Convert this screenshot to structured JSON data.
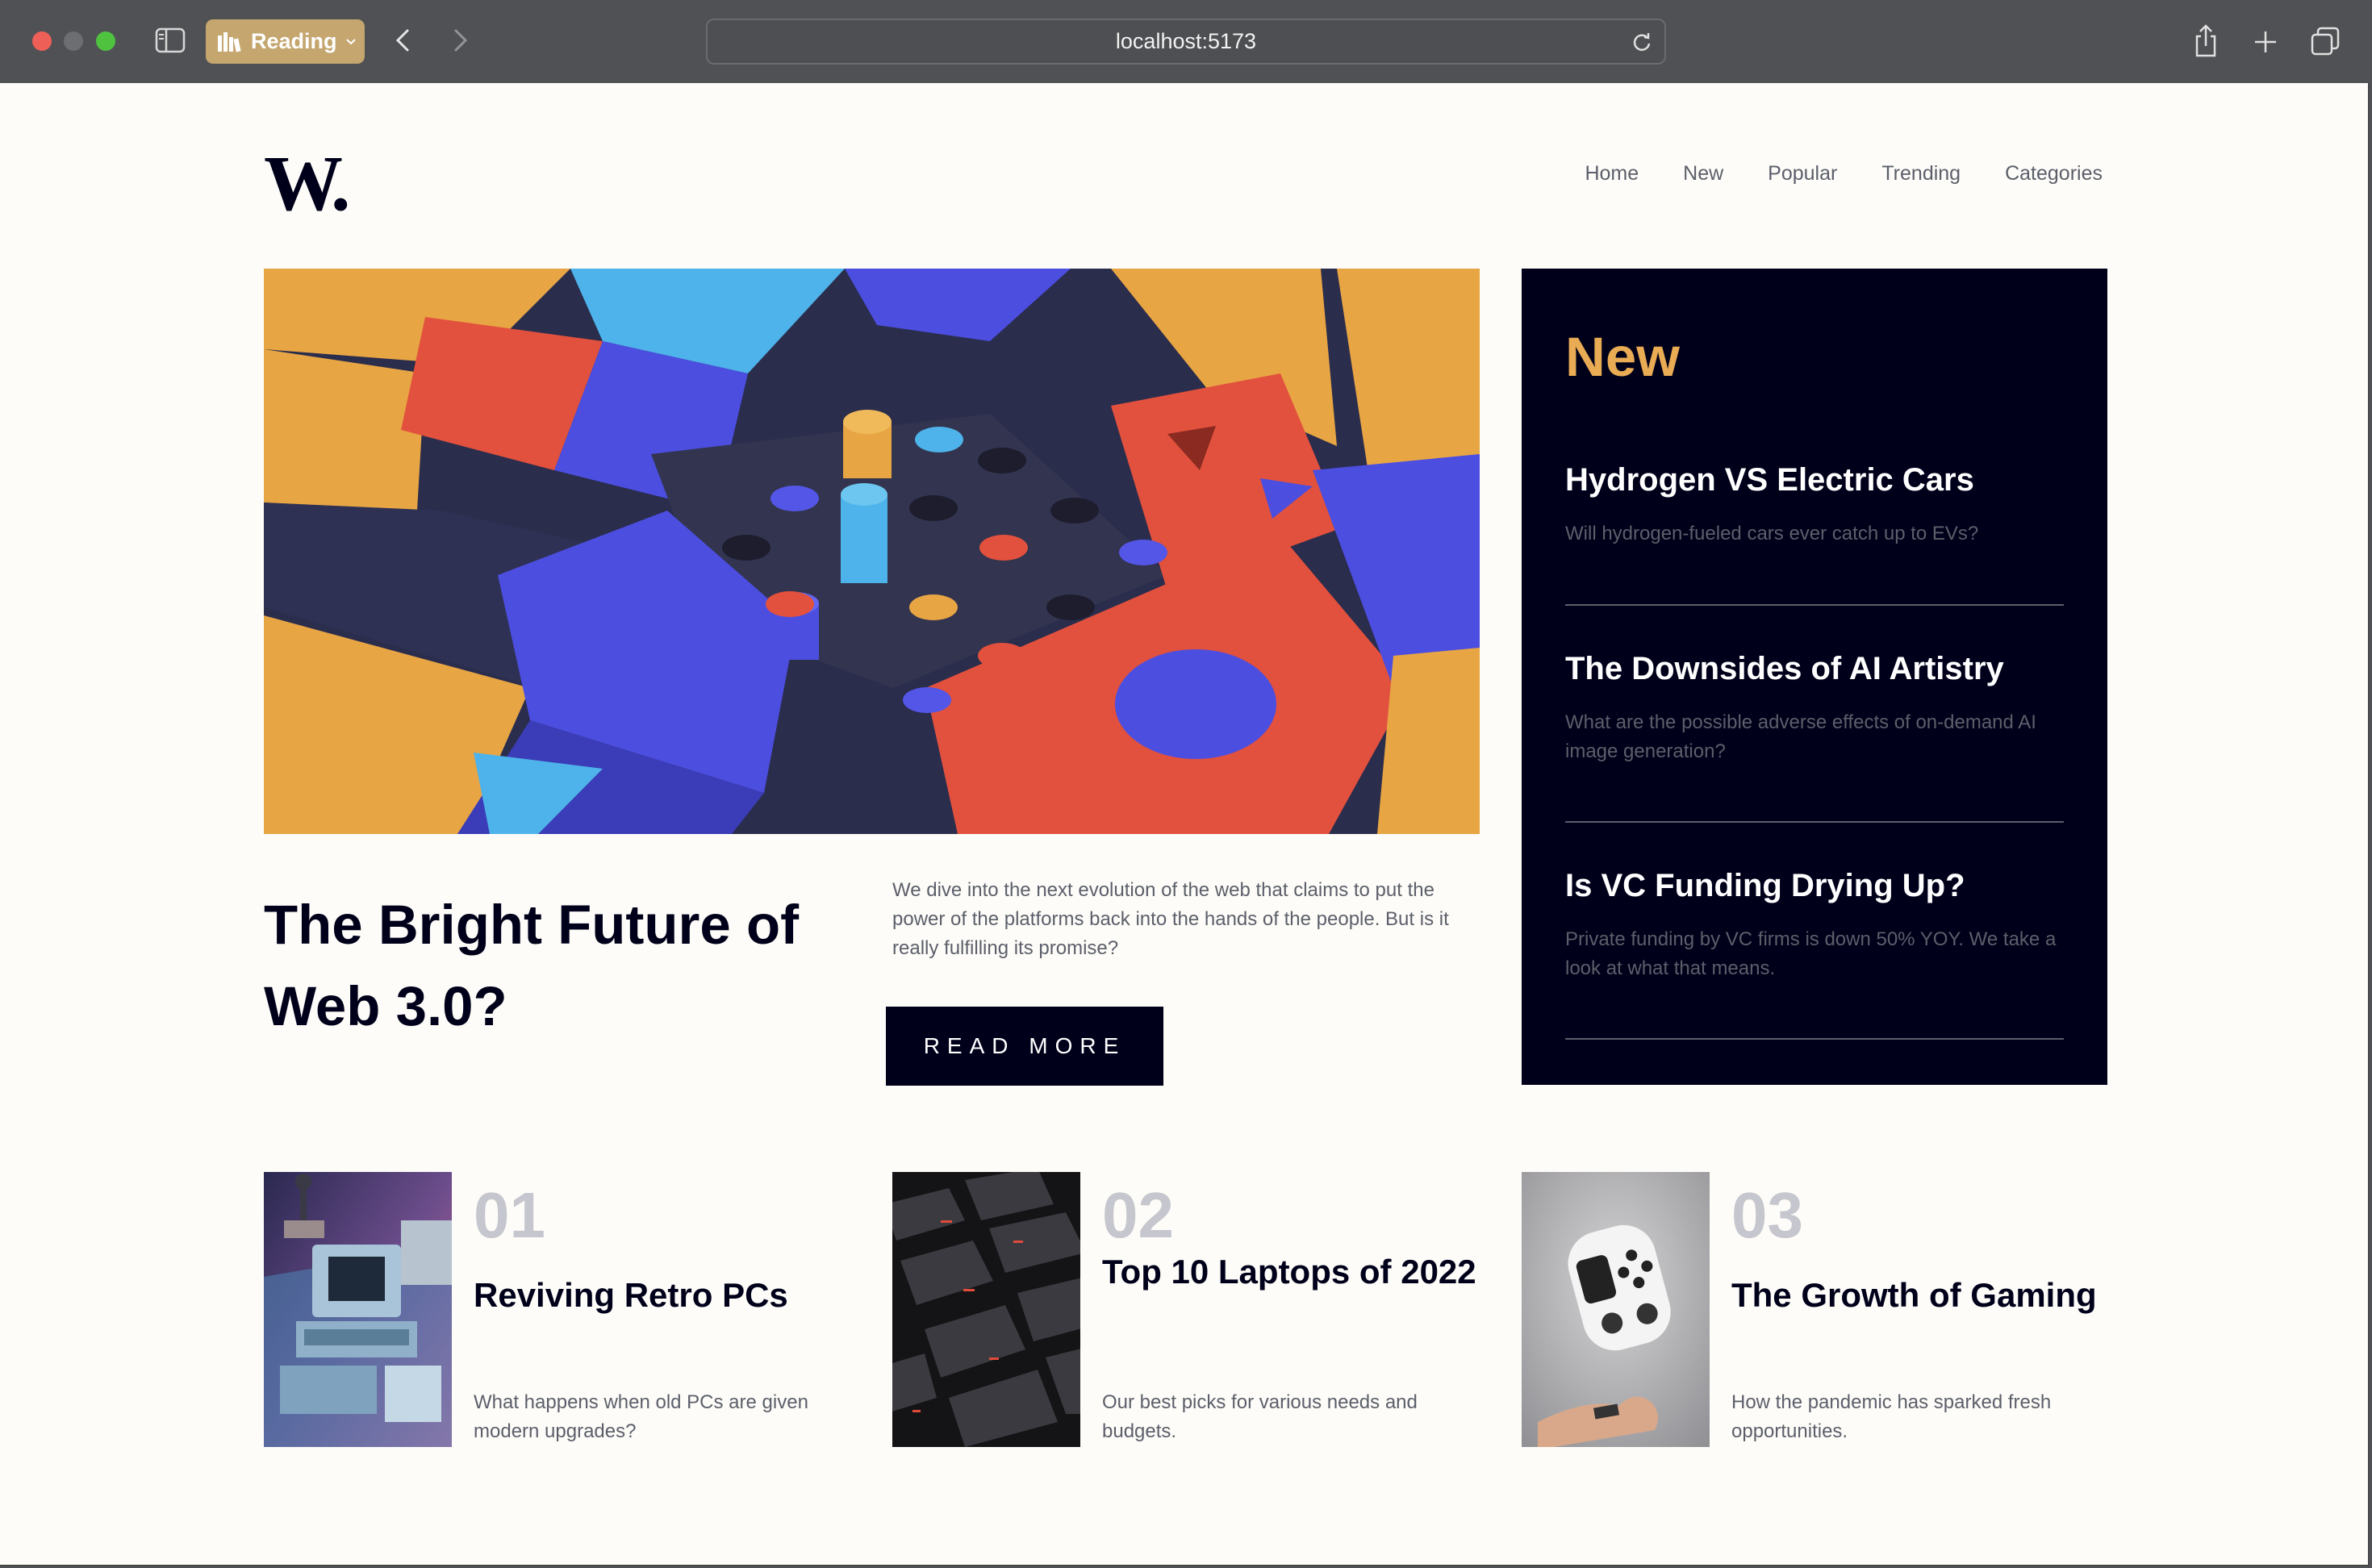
{
  "browser": {
    "profile_label": "Reading",
    "url": "localhost:5173"
  },
  "site": {
    "logo": "W.",
    "nav": [
      "Home",
      "New",
      "Popular",
      "Trending",
      "Categories"
    ]
  },
  "hero": {
    "title": "The Bright Future of Web 3.0?",
    "description": "We dive into the next evolution of the web that claims to put the power of the platforms back into the hands of the people. But is it really fulfilling its promise?",
    "button_label": "READ MORE"
  },
  "new_panel": {
    "title": "New",
    "items": [
      {
        "title": "Hydrogen VS Electric Cars",
        "description": "Will hydrogen-fueled cars ever catch up to EVs?"
      },
      {
        "title": "The Downsides of AI Artistry",
        "description": "What are the possible adverse effects of on-demand AI image generation?"
      },
      {
        "title": "Is VC Funding Drying Up?",
        "description": "Private funding by VC firms is down 50% YOY. We take a look at what that means."
      }
    ]
  },
  "cards": [
    {
      "number": "01",
      "title": "Reviving Retro PCs",
      "description": "What happens when old PCs are given modern upgrades?"
    },
    {
      "number": "02",
      "title": "Top 10 Laptops of 2022",
      "description": "Our best picks for various needs and budgets."
    },
    {
      "number": "03",
      "title": "The Growth of Gaming",
      "description": "How the pandemic has sparked fresh opportunities."
    }
  ],
  "colors": {
    "accent": "#e9ab53",
    "dark": "#00001a",
    "muted": "#5c5f6a",
    "background": "#fdfcf8"
  }
}
